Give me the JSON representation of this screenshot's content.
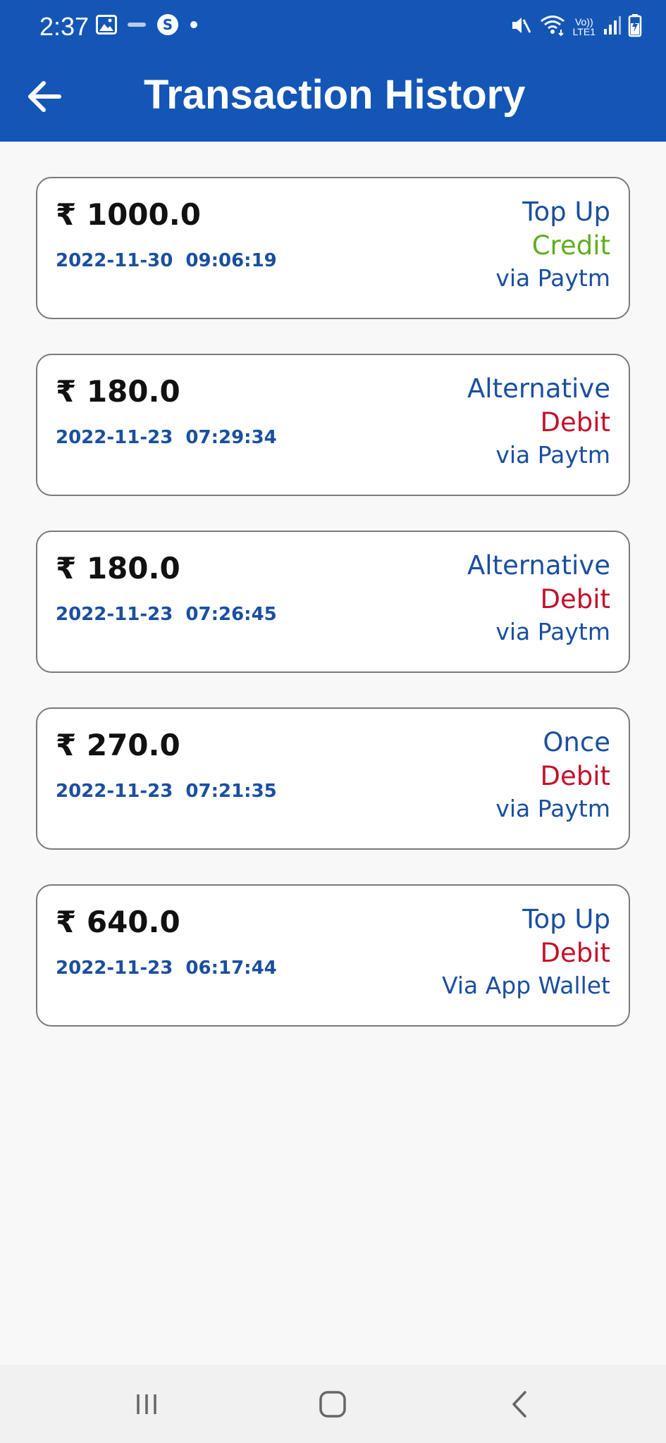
{
  "status_bar": {
    "time": "2:37",
    "network_top": "Vo))",
    "network_bottom": "LTE1",
    "icons": [
      "gallery-icon",
      "notification-icon",
      "skype-icon",
      "dot-icon",
      "mute-icon",
      "wifi-icon",
      "signal-icon",
      "battery-icon"
    ]
  },
  "header": {
    "title": "Transaction History",
    "back_icon": "arrow-left-icon",
    "background_color": "#1456b6"
  },
  "transactions": [
    {
      "amount": "₹ 1000.0",
      "date": "2022-11-30",
      "time": "09:06:19",
      "type": "Top Up",
      "direction": "Credit",
      "via": "via Paytm"
    },
    {
      "amount": "₹ 180.0",
      "date": "2022-11-23",
      "time": "07:29:34",
      "type": "Alternative",
      "direction": "Debit",
      "via": "via Paytm"
    },
    {
      "amount": "₹ 180.0",
      "date": "2022-11-23",
      "time": "07:26:45",
      "type": "Alternative",
      "direction": "Debit",
      "via": "via Paytm"
    },
    {
      "amount": "₹ 270.0",
      "date": "2022-11-23",
      "time": "07:21:35",
      "type": "Once",
      "direction": "Debit",
      "via": "via Paytm"
    },
    {
      "amount": "₹ 640.0",
      "date": "2022-11-23",
      "time": "06:17:44",
      "type": "Top Up",
      "direction": "Debit",
      "via": "Via App Wallet"
    }
  ],
  "colors": {
    "credit": "#5fae1c",
    "debit": "#c2102a",
    "accent_text": "#1a4fa0"
  },
  "system_nav": {
    "icons": [
      "recent-apps-icon",
      "home-icon",
      "back-icon"
    ]
  }
}
